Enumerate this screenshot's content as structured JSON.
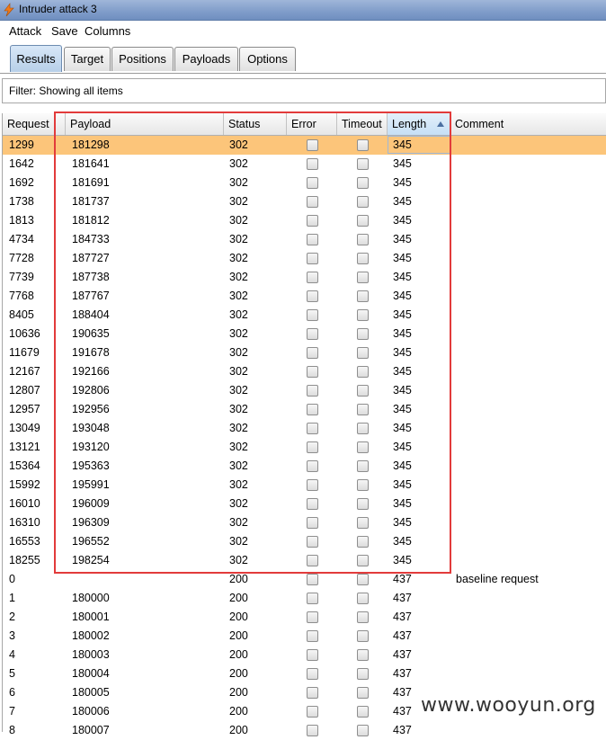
{
  "window": {
    "title": "Intruder attack 3"
  },
  "menu": [
    "Attack",
    "Save",
    "Columns"
  ],
  "tabs": [
    "Results",
    "Target",
    "Positions",
    "Payloads",
    "Options"
  ],
  "active_tab": "Results",
  "filter": {
    "text": "Filter: Showing all items"
  },
  "table": {
    "columns": [
      "Request",
      "Payload",
      "Status",
      "Error",
      "Timeout",
      "Length",
      "Comment"
    ],
    "sort": {
      "column": "Length",
      "direction": "ascending"
    },
    "selected_row": 0,
    "rows": [
      {
        "request": "1299",
        "payload": "181298",
        "status": "302",
        "error": false,
        "timeout": false,
        "length": "345",
        "comment": ""
      },
      {
        "request": "1642",
        "payload": "181641",
        "status": "302",
        "error": false,
        "timeout": false,
        "length": "345",
        "comment": ""
      },
      {
        "request": "1692",
        "payload": "181691",
        "status": "302",
        "error": false,
        "timeout": false,
        "length": "345",
        "comment": ""
      },
      {
        "request": "1738",
        "payload": "181737",
        "status": "302",
        "error": false,
        "timeout": false,
        "length": "345",
        "comment": ""
      },
      {
        "request": "1813",
        "payload": "181812",
        "status": "302",
        "error": false,
        "timeout": false,
        "length": "345",
        "comment": ""
      },
      {
        "request": "4734",
        "payload": "184733",
        "status": "302",
        "error": false,
        "timeout": false,
        "length": "345",
        "comment": ""
      },
      {
        "request": "7728",
        "payload": "187727",
        "status": "302",
        "error": false,
        "timeout": false,
        "length": "345",
        "comment": ""
      },
      {
        "request": "7739",
        "payload": "187738",
        "status": "302",
        "error": false,
        "timeout": false,
        "length": "345",
        "comment": ""
      },
      {
        "request": "7768",
        "payload": "187767",
        "status": "302",
        "error": false,
        "timeout": false,
        "length": "345",
        "comment": ""
      },
      {
        "request": "8405",
        "payload": "188404",
        "status": "302",
        "error": false,
        "timeout": false,
        "length": "345",
        "comment": ""
      },
      {
        "request": "10636",
        "payload": "190635",
        "status": "302",
        "error": false,
        "timeout": false,
        "length": "345",
        "comment": ""
      },
      {
        "request": "11679",
        "payload": "191678",
        "status": "302",
        "error": false,
        "timeout": false,
        "length": "345",
        "comment": ""
      },
      {
        "request": "12167",
        "payload": "192166",
        "status": "302",
        "error": false,
        "timeout": false,
        "length": "345",
        "comment": ""
      },
      {
        "request": "12807",
        "payload": "192806",
        "status": "302",
        "error": false,
        "timeout": false,
        "length": "345",
        "comment": ""
      },
      {
        "request": "12957",
        "payload": "192956",
        "status": "302",
        "error": false,
        "timeout": false,
        "length": "345",
        "comment": ""
      },
      {
        "request": "13049",
        "payload": "193048",
        "status": "302",
        "error": false,
        "timeout": false,
        "length": "345",
        "comment": ""
      },
      {
        "request": "13121",
        "payload": "193120",
        "status": "302",
        "error": false,
        "timeout": false,
        "length": "345",
        "comment": ""
      },
      {
        "request": "15364",
        "payload": "195363",
        "status": "302",
        "error": false,
        "timeout": false,
        "length": "345",
        "comment": ""
      },
      {
        "request": "15992",
        "payload": "195991",
        "status": "302",
        "error": false,
        "timeout": false,
        "length": "345",
        "comment": ""
      },
      {
        "request": "16010",
        "payload": "196009",
        "status": "302",
        "error": false,
        "timeout": false,
        "length": "345",
        "comment": ""
      },
      {
        "request": "16310",
        "payload": "196309",
        "status": "302",
        "error": false,
        "timeout": false,
        "length": "345",
        "comment": ""
      },
      {
        "request": "16553",
        "payload": "196552",
        "status": "302",
        "error": false,
        "timeout": false,
        "length": "345",
        "comment": ""
      },
      {
        "request": "18255",
        "payload": "198254",
        "status": "302",
        "error": false,
        "timeout": false,
        "length": "345",
        "comment": ""
      },
      {
        "request": "0",
        "payload": "",
        "status": "200",
        "error": false,
        "timeout": false,
        "length": "437",
        "comment": "baseline request"
      },
      {
        "request": "1",
        "payload": "180000",
        "status": "200",
        "error": false,
        "timeout": false,
        "length": "437",
        "comment": ""
      },
      {
        "request": "2",
        "payload": "180001",
        "status": "200",
        "error": false,
        "timeout": false,
        "length": "437",
        "comment": ""
      },
      {
        "request": "3",
        "payload": "180002",
        "status": "200",
        "error": false,
        "timeout": false,
        "length": "437",
        "comment": ""
      },
      {
        "request": "4",
        "payload": "180003",
        "status": "200",
        "error": false,
        "timeout": false,
        "length": "437",
        "comment": ""
      },
      {
        "request": "5",
        "payload": "180004",
        "status": "200",
        "error": false,
        "timeout": false,
        "length": "437",
        "comment": ""
      },
      {
        "request": "6",
        "payload": "180005",
        "status": "200",
        "error": false,
        "timeout": false,
        "length": "437",
        "comment": ""
      },
      {
        "request": "7",
        "payload": "180006",
        "status": "200",
        "error": false,
        "timeout": false,
        "length": "437",
        "comment": ""
      },
      {
        "request": "8",
        "payload": "180007",
        "status": "200",
        "error": false,
        "timeout": false,
        "length": "437",
        "comment": ""
      }
    ]
  },
  "watermark": "www.wooyun.org",
  "colors": {
    "selected_row": "#fcc57a",
    "highlight_box": "#e23b3b"
  }
}
